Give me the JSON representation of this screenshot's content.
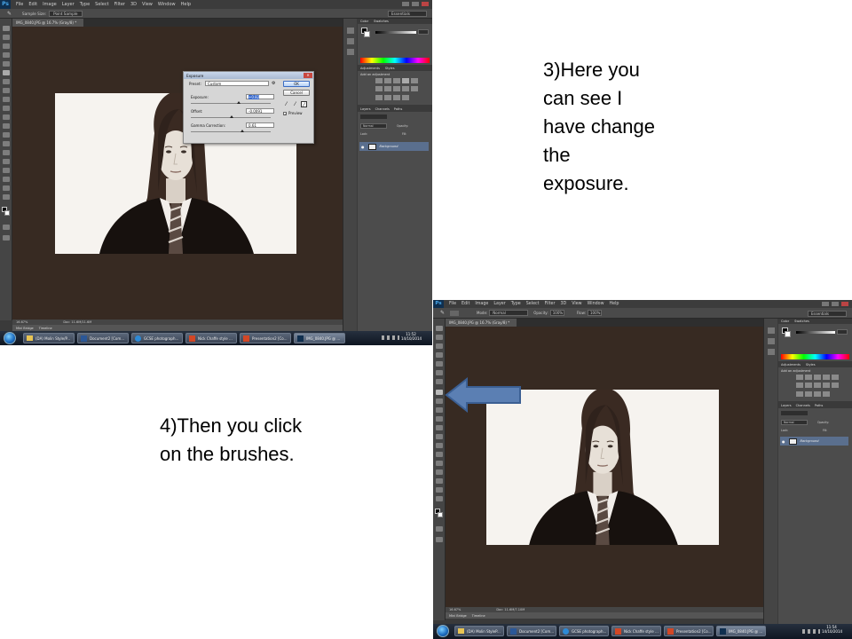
{
  "captions": {
    "step3": " 3)Here you\ncan see I\nhave change\nthe\nexposure.",
    "step4": "4)Then you click\non the brushes."
  },
  "colors": {
    "canvas_bg": "#372a22",
    "photo_bg": "#f6f3ef",
    "ps_logo": "#47a5e8",
    "arrow_fill": "#5b7fb3",
    "arrow_stroke": "#3b5f93"
  },
  "ps1": {
    "logo": "Ps",
    "menus": [
      "File",
      "Edit",
      "Image",
      "Layer",
      "Type",
      "Select",
      "Filter",
      "3D",
      "View",
      "Window",
      "Help"
    ],
    "options": {
      "sample_size_label": "Sample Size:",
      "sample_size_value": "Point Sample"
    },
    "workspace": "Essentials",
    "doc_tab": "IMG_0840.JPG @ 16.7% (Gray/8) *",
    "status": {
      "zoom": "16.67%",
      "doc": "Doc: 11.6M/11.6M"
    },
    "bridge_tabs": [
      "Mini Bridge",
      "Timeline"
    ],
    "panels": {
      "color_tabs": [
        "Color",
        "Swatches"
      ],
      "adjustments_tabs": [
        "Adjustments",
        "Styles"
      ],
      "adjustments_hint": "Add an adjustment",
      "layers_tabs": [
        "Layers",
        "Channels",
        "Paths"
      ],
      "blend_mode": "Normal",
      "opacity_label": "Opacity:",
      "lock_label": "Lock:",
      "fill_label": "Fill:",
      "layer_name": "Background"
    },
    "dialog": {
      "title": "Exposure",
      "preset_label": "Preset:",
      "preset_value": "Custom",
      "exposure_label": "Exposure:",
      "exposure_value": "+0.82",
      "offset_label": "Offset:",
      "offset_value": "-0.0091",
      "gamma_label": "Gamma Correction:",
      "gamma_value": "0.61",
      "ok_label": "OK",
      "cancel_label": "Cancel",
      "preview_label": "Preview",
      "preview_checked": true
    },
    "taskbar": {
      "items": [
        "(DA) Molin Style/P...",
        "Document2 [Com...",
        "GCSE photograph...",
        "Nick Chaffe style ...",
        "Presentation2 [Co...",
        "IMG_0840.JPG @ ..."
      ],
      "time": "11:52",
      "date": "14/10/2014"
    }
  },
  "ps2": {
    "logo": "Ps",
    "menus": [
      "File",
      "Edit",
      "Image",
      "Layer",
      "Type",
      "Select",
      "Filter",
      "3D",
      "View",
      "Window",
      "Help"
    ],
    "options": {
      "mode_label": "Mode:",
      "mode_value": "Normal",
      "opacity_label": "Opacity:",
      "opacity_value": "100%",
      "flow_label": "Flow:",
      "flow_value": "100%"
    },
    "workspace": "Essentials",
    "doc_tab": "IMG_0840.JPG @ 16.7% (Gray/8) *",
    "status": {
      "zoom": "16.67%",
      "doc": "Doc: 11.6M/7.10M"
    },
    "bridge_tabs": [
      "Mini Bridge",
      "Timeline"
    ],
    "panels": {
      "color_tabs": [
        "Color",
        "Swatches"
      ],
      "adjustments_tabs": [
        "Adjustments",
        "Styles"
      ],
      "adjustments_hint": "Add an adjustment",
      "layers_tabs": [
        "Layers",
        "Channels",
        "Paths"
      ],
      "blend_mode": "Normal",
      "opacity_label": "Opacity:",
      "lock_label": "Lock:",
      "fill_label": "Fill:",
      "layer_name": "Background"
    },
    "taskbar": {
      "items": [
        "(DA) Molin StyleP...",
        "Document2 [Com...",
        "GCSE photograph...",
        "Nick Chaffe style ...",
        "Presentation2 [Co...",
        "IMG_0840.JPG @ ..."
      ],
      "time": "11:54",
      "date": "14/10/2014"
    }
  }
}
